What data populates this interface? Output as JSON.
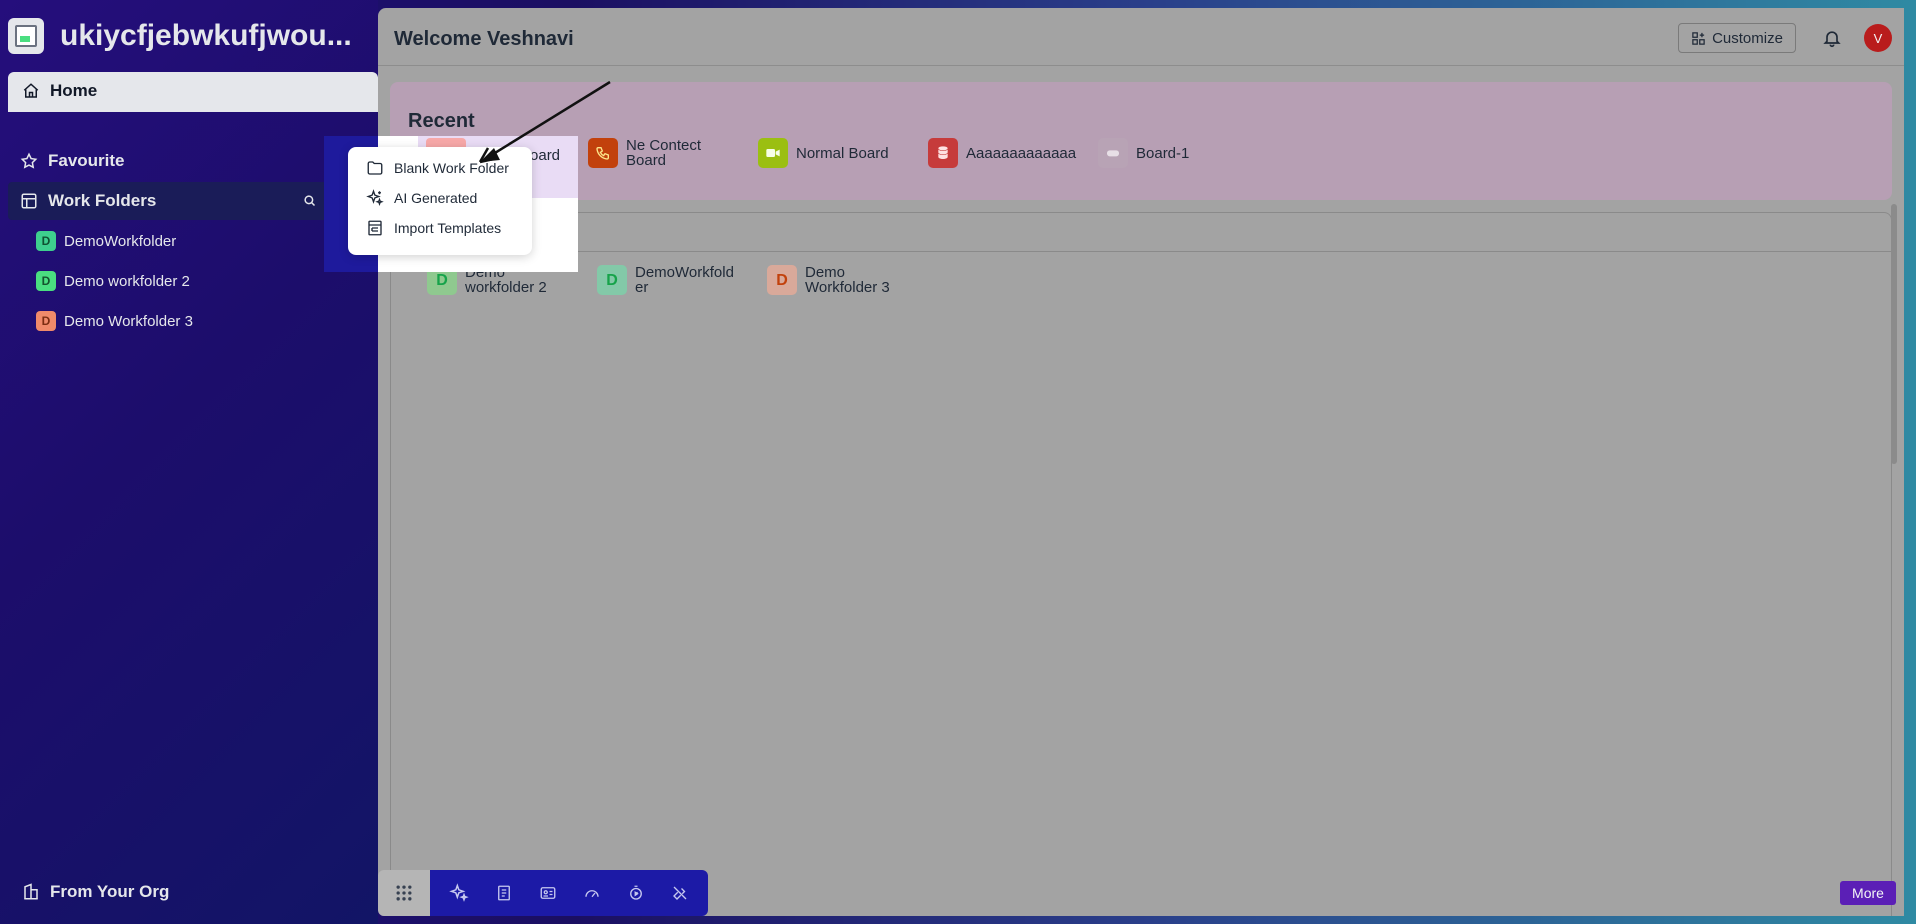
{
  "sidebar": {
    "org_name": "ukiycfjebwkufjwou...",
    "home_label": "Home",
    "favourite_label": "Favourite",
    "work_folders_label": "Work Folders",
    "folders": [
      {
        "initial": "D",
        "name": "DemoWorkfolder",
        "color": "#3ecf8e"
      },
      {
        "initial": "D",
        "name": "Demo workfolder 2",
        "color": "#4ade80"
      },
      {
        "initial": "D",
        "name": "Demo Workfolder 3",
        "color": "#f08a6a"
      }
    ],
    "from_org_label": "From Your Org"
  },
  "header": {
    "welcome": "Welcome Veshnavi",
    "customize_label": "Customize",
    "avatar_initial": "V"
  },
  "recent": {
    "title": "Recent",
    "items": [
      {
        "label": "Board",
        "icon": "board-icon"
      },
      {
        "label": "Ne Contect Board",
        "line1": "Ne Contect",
        "line2": "Board",
        "icon": "phone-icon",
        "color": "#c2410c"
      },
      {
        "label": "Normal Board",
        "icon": "video-icon",
        "color": "#9bbf11"
      },
      {
        "label": "Aaaaaaaaaaaaa",
        "icon": "database-icon",
        "color": "#c63b3b"
      },
      {
        "label": "Board-1",
        "icon": "gamepad-icon",
        "color": "#b8a3b5"
      }
    ]
  },
  "work_folders_section": {
    "items": [
      {
        "initial": "D",
        "line1": "Demo",
        "line2": "workfolder 2",
        "bg": "#8fc98f",
        "fg": "#16a34a"
      },
      {
        "initial": "D",
        "line1": "DemoWorkfold",
        "line2": "er",
        "bg": "#83c9a8",
        "fg": "#16a34a"
      },
      {
        "initial": "D",
        "line1": "Demo",
        "line2": "Workfolder 3",
        "bg": "#d9a99a",
        "fg": "#c2410c"
      }
    ]
  },
  "dropdown": {
    "items": [
      {
        "label": "Blank Work Folder",
        "icon": "folder-icon"
      },
      {
        "label": "AI Generated",
        "icon": "sparkles-icon"
      },
      {
        "label": "Import Templates",
        "icon": "template-icon"
      }
    ]
  },
  "toolbar": {
    "more_label": "More"
  }
}
